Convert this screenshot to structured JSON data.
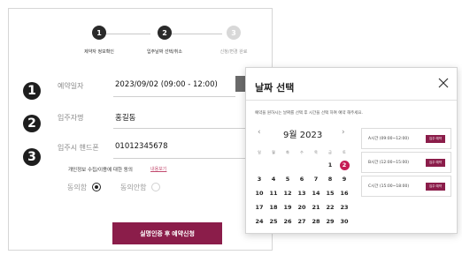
{
  "steps": [
    {
      "number": "1",
      "label": "제약자 정보확인"
    },
    {
      "number": "2",
      "label": "입주날짜 선택/취소"
    },
    {
      "number": "3",
      "label": "신청/변경 완료"
    }
  ],
  "markers": [
    "1",
    "2",
    "3"
  ],
  "form": {
    "reservation_date_label": "예약일자",
    "reservation_date_value": "2023/09/02 (09:00 - 12:00)",
    "resident_name_label": "입주자명",
    "resident_name_value": "홍길동",
    "resident_phone_label": "입주시 핸드폰",
    "resident_phone_value": "01012345678",
    "consent_label": "개인정보 수집/이용에 대한 동의",
    "consent_link": "내용보기",
    "agree_label": "동의함",
    "disagree_label": "동의안함",
    "consent_agreed": true,
    "submit_label": "실명인증 후 예약신청"
  },
  "modal": {
    "title": "날짜 선택",
    "close_icon": "close-icon",
    "description": "예약을 원하시는 날짜를 선택 후 시간을 선택 하여 예약 해주세요.",
    "month_label": "9월 2023",
    "prev_label": "‹",
    "next_label": "›",
    "weekdays": [
      "일",
      "월",
      "화",
      "수",
      "목",
      "금",
      "토"
    ],
    "weeks": [
      [
        "",
        "",
        "",
        "",
        "",
        "1",
        "2"
      ],
      [
        "3",
        "4",
        "5",
        "6",
        "7",
        "8",
        "9"
      ],
      [
        "10",
        "11",
        "12",
        "13",
        "14",
        "15",
        "16"
      ],
      [
        "17",
        "18",
        "19",
        "20",
        "21",
        "22",
        "23"
      ],
      [
        "24",
        "25",
        "26",
        "27",
        "28",
        "29",
        "30"
      ]
    ],
    "selected_day": "2",
    "slots": [
      {
        "label": "A시간 (09:00~12:00)",
        "button": "입주 예약"
      },
      {
        "label": "B시간 (12:00~15:00)",
        "button": "입주 예약"
      },
      {
        "label": "C시간 (15:00~18:00)",
        "button": "입주 예약"
      }
    ]
  },
  "colors": {
    "accent": "#8b1d4a",
    "selected_day": "#c51c55",
    "marker": "#1e1e1e"
  }
}
